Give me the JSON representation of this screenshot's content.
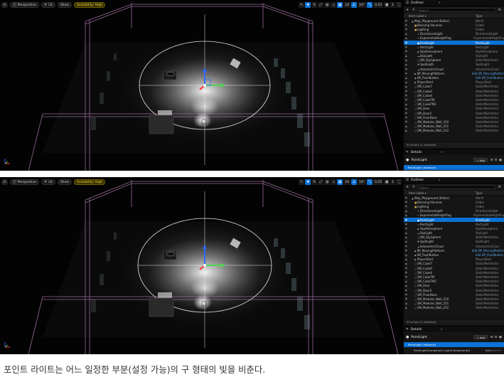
{
  "caption": "포인트 라이트는 어느 일정한 부분(설정 가능)의 구 형태의 빛을 비춘다.",
  "viewport": {
    "menu_icon": "hamburger-icon",
    "perspective_label": "Perspective",
    "lit_label": "Lit",
    "show_label": "Show",
    "scalability_label": "Scalability: High",
    "grid_snap_value": "10",
    "rotate_snap_value": "10°",
    "scale_snap_value": "0.25",
    "camera_speed_value": "1"
  },
  "outliner": {
    "tab_title": "Outliner",
    "search_placeholder": "Search",
    "col_item_label": "Item Label ▾",
    "col_type": "Type",
    "rows": [
      {
        "label": "Map_Playground (Editor)",
        "type": "World",
        "indent": 1,
        "kind": "world",
        "icon": "▲"
      },
      {
        "label": "Blocking Volumes",
        "type": "Folder",
        "indent": 2,
        "kind": "folder",
        "icon": "■"
      },
      {
        "label": "Lighting",
        "type": "Folder",
        "indent": 2,
        "kind": "folder",
        "icon": "■"
      },
      {
        "label": "DirectionalLight",
        "type": "DirectionalLight",
        "indent": 3,
        "kind": "actor",
        "icon": "☀"
      },
      {
        "label": "ExponentialHeightFog",
        "type": "ExponentialHeightFog",
        "indent": 3,
        "kind": "actor",
        "icon": "≈"
      },
      {
        "label": "PointLight",
        "type": "PointLight",
        "indent": 3,
        "kind": "actor",
        "icon": "●",
        "selected": true
      },
      {
        "label": "RectLight",
        "type": "RectLight",
        "indent": 3,
        "kind": "actor",
        "icon": "▭"
      },
      {
        "label": "SkyAtmosphere",
        "type": "SkyAtmosphere",
        "indent": 3,
        "kind": "actor",
        "icon": "◐"
      },
      {
        "label": "SkyLight",
        "type": "SkyLight",
        "indent": 3,
        "kind": "actor",
        "icon": "☁"
      },
      {
        "label": "SM_SkySphere",
        "type": "StaticMeshActor",
        "indent": 3,
        "kind": "actor",
        "icon": "◯"
      },
      {
        "label": "SpotLight",
        "type": "SpotLight",
        "indent": 3,
        "kind": "actor",
        "icon": "▼"
      },
      {
        "label": "VolumetricCloud",
        "type": "VolumetricCloud",
        "indent": 3,
        "kind": "actor",
        "icon": "☁"
      },
      {
        "label": "BP_MovingPlatform",
        "type": "Edit BP_MovingPlatform",
        "indent": 2,
        "kind": "actor",
        "icon": "◆",
        "link": true
      },
      {
        "label": "BP_PushButton",
        "type": "Edit BP_PushButton",
        "indent": 2,
        "kind": "actor",
        "icon": "◆",
        "link": true
      },
      {
        "label": "PlayerStart",
        "type": "PlayerStart",
        "indent": 2,
        "kind": "actor",
        "icon": "▶"
      },
      {
        "label": "SM_Cube7",
        "type": "StaticMeshActor",
        "indent": 2,
        "kind": "actor",
        "icon": "□"
      },
      {
        "label": "SM_Cube0",
        "type": "StaticMeshActor",
        "indent": 2,
        "kind": "actor",
        "icon": "□"
      },
      {
        "label": "SM_Cube4",
        "type": "StaticMeshActor",
        "indent": 2,
        "kind": "actor",
        "icon": "□"
      },
      {
        "label": "SM_CubeTM",
        "type": "StaticMeshActor",
        "indent": 2,
        "kind": "actor",
        "icon": "□"
      },
      {
        "label": "SM_CubeTM2",
        "type": "StaticMeshActor",
        "indent": 2,
        "kind": "actor",
        "icon": "□"
      },
      {
        "label": "SM_Door",
        "type": "StaticMeshActor",
        "indent": 2,
        "kind": "actor",
        "icon": "□"
      },
      {
        "label": "SM_Door2",
        "type": "StaticMeshActor",
        "indent": 2,
        "kind": "actor",
        "icon": "□"
      },
      {
        "label": "SM_FloorBase",
        "type": "StaticMeshActor",
        "indent": 2,
        "kind": "actor",
        "icon": "□"
      },
      {
        "label": "SM_Modular_Wall_250",
        "type": "StaticMeshActor",
        "indent": 2,
        "kind": "actor",
        "icon": "□"
      },
      {
        "label": "SM_Modular_Wall_251",
        "type": "StaticMeshActor",
        "indent": 2,
        "kind": "actor",
        "icon": "□"
      },
      {
        "label": "SM_Modular_Wall_252",
        "type": "StaticMeshActor",
        "indent": 2,
        "kind": "actor",
        "icon": "□"
      }
    ],
    "status": "53 actors (1 selected)"
  },
  "details": {
    "tab_title": "Details",
    "object_name": "PointLight",
    "add_label": "+ Add",
    "component_label": "PointLight (Instance)",
    "sub_component": "PointLightComponent (LightComponent0)",
    "edit_label": "Edit in C++"
  },
  "colors": {
    "selection_blue": "#0b72d6",
    "scalability_yellow": "#f2d44a",
    "volume_pink": "#b07ab4",
    "gizmo_z": "#2f6bff",
    "gizmo_x": "#ff3030",
    "gizmo_y": "#4fd64f"
  }
}
